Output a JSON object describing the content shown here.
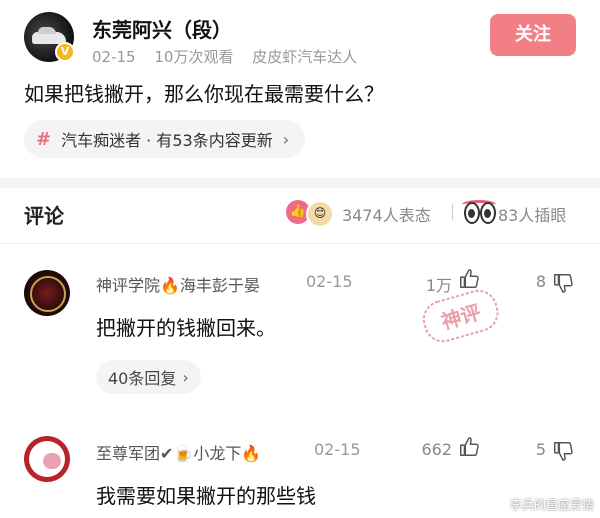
{
  "post": {
    "author": "东莞阿兴（段）",
    "date": "02-15",
    "views": "10万次观看",
    "tag": "皮皮虾汽车达人",
    "follow_label": "关注",
    "question": "如果把钱撇开，那么你现在最需要什么？",
    "topic": {
      "hash": "#",
      "label": "汽车痴迷者 · 有53条内容更新",
      "chevron": "›"
    }
  },
  "comments_header": {
    "title": "评论",
    "reactions": "3474人表态",
    "inserts": "83人插眼"
  },
  "comments": [
    {
      "name": "神评学院🔥海丰彭于晏",
      "date": "02-15",
      "likes": "1万",
      "dislikes": "8",
      "text": "把撇开的钱撇回来。",
      "replies": "40条回复",
      "stamp": "神评"
    },
    {
      "name": "至尊军团✔🍺小龙下🔥",
      "date": "02-15",
      "likes": "662",
      "dislikes": "5",
      "text": "我需要如果撇开的那些钱"
    }
  ],
  "watermark": "李兵的星座爱情",
  "colors": {
    "accent": "#f27f86",
    "topic_hash": "#e8707a",
    "stamp": "#e56b7b"
  }
}
